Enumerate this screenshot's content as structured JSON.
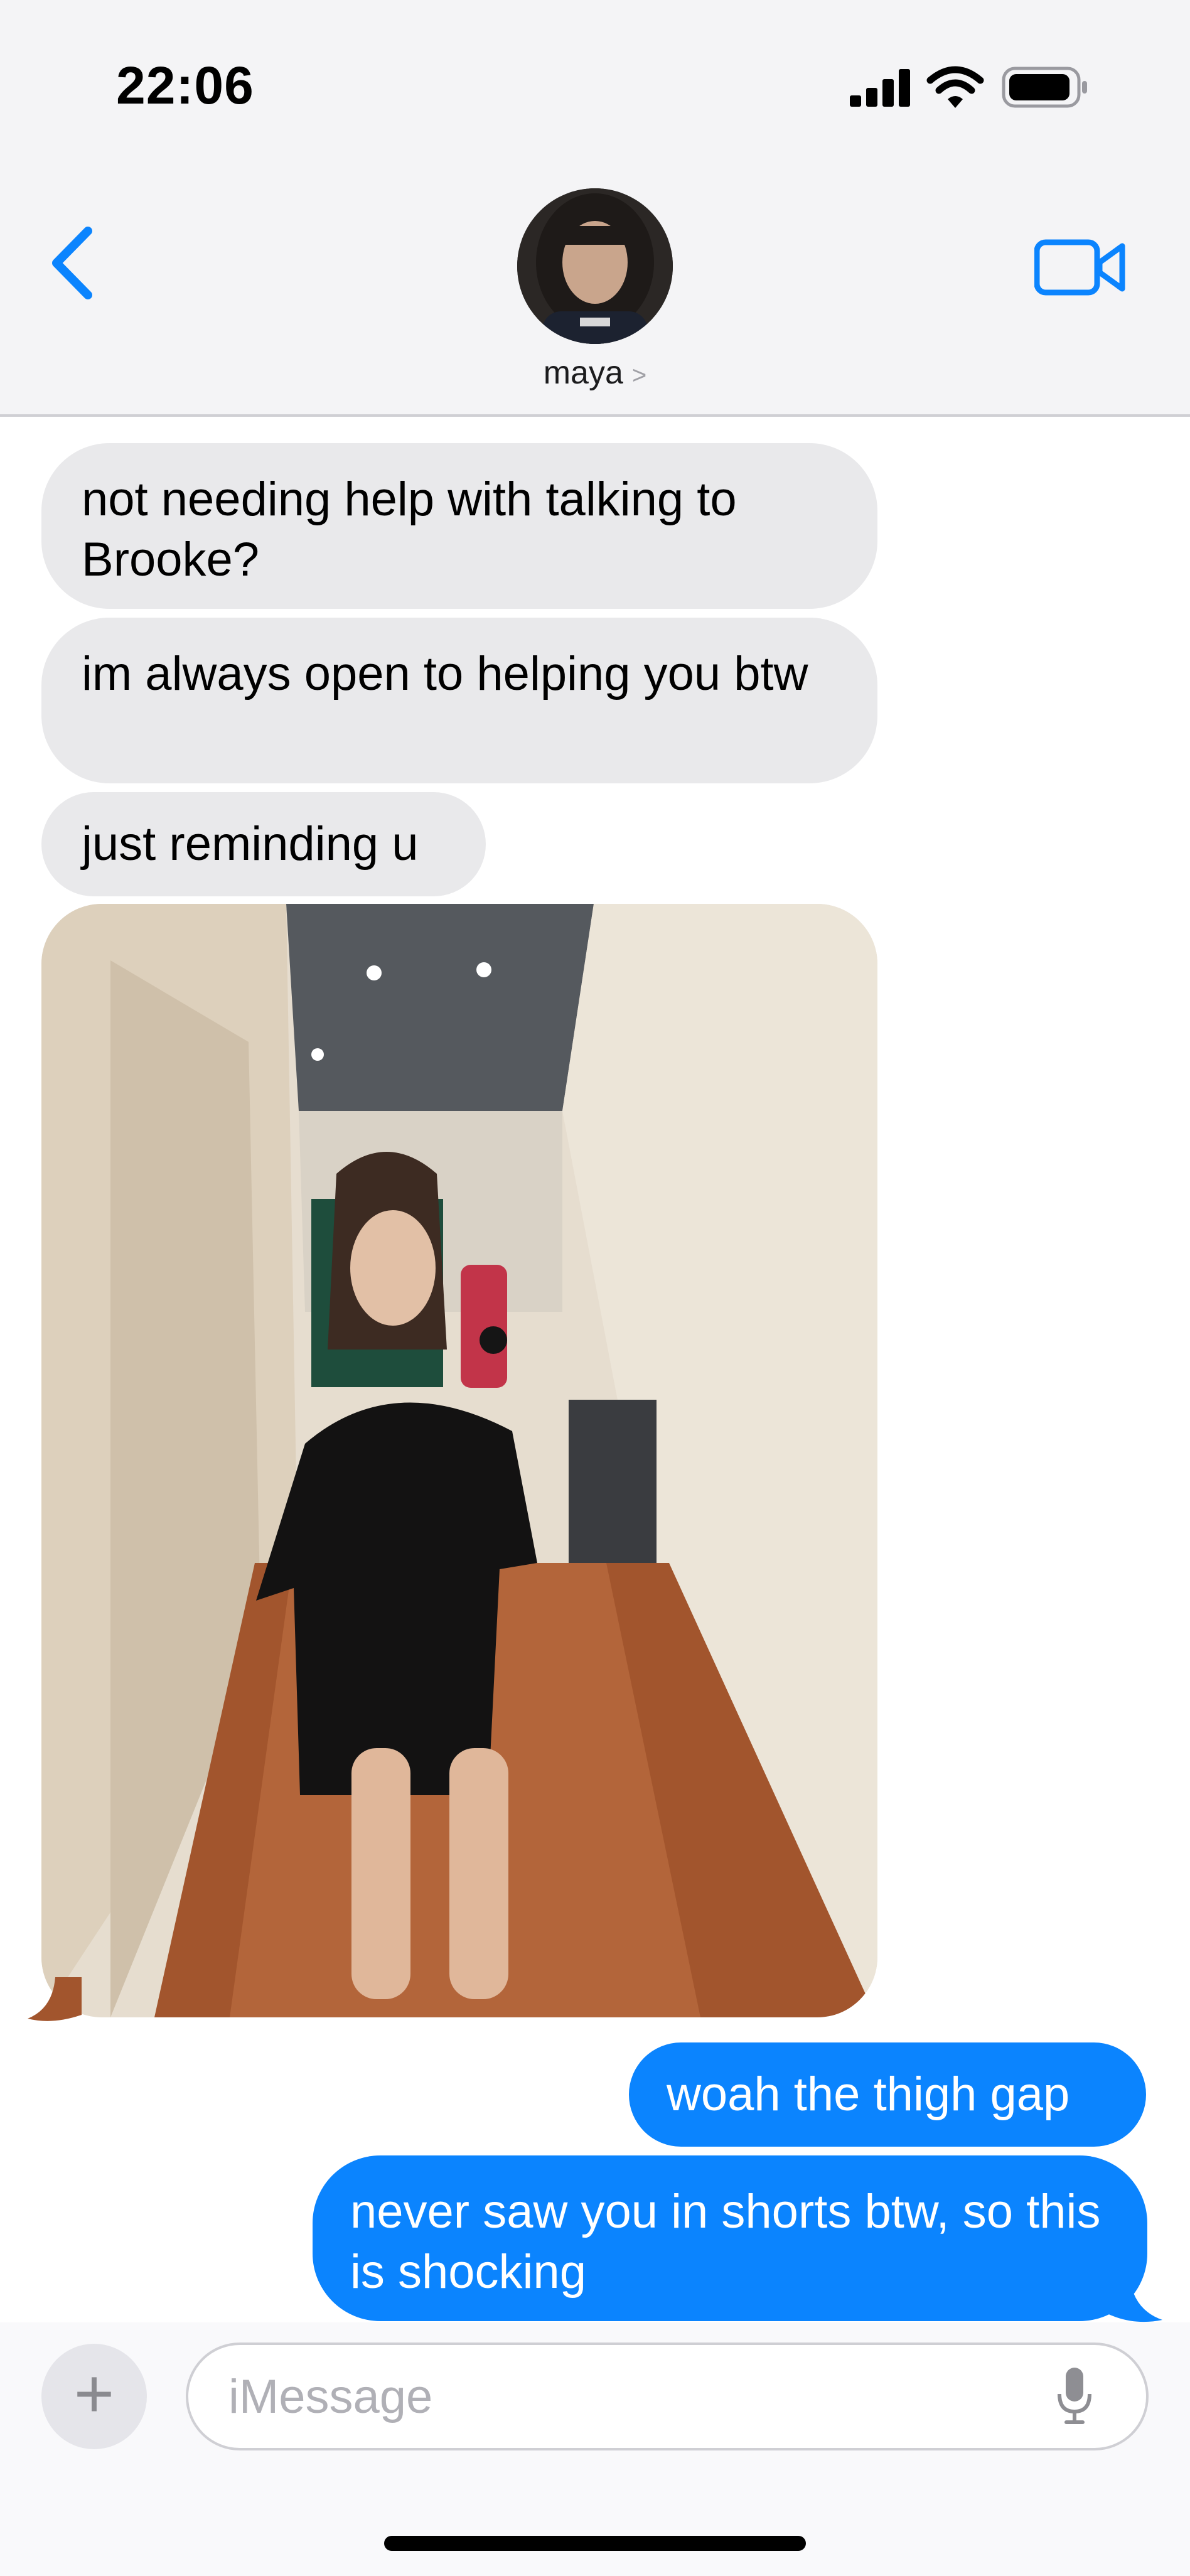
{
  "status_bar": {
    "time": "22:06",
    "icons": [
      "signal-icon",
      "wifi-icon",
      "battery-icon"
    ]
  },
  "header": {
    "back_icon": "chevron-left-icon",
    "contact_name": "maya",
    "name_chevron": ">",
    "video_icon": "video-camera-icon",
    "accent_color": "#0b84fe"
  },
  "messages": [
    {
      "direction": "received",
      "text": "not needing help with talking to Brooke?"
    },
    {
      "direction": "received",
      "text": "im always open to helping you btw"
    },
    {
      "direction": "received",
      "text": "just reminding u"
    },
    {
      "direction": "received",
      "type": "photo"
    },
    {
      "direction": "sent",
      "text": "woah the thigh gap"
    },
    {
      "direction": "sent",
      "text": "never saw you in shorts btw, so this is shocking"
    }
  ],
  "colors": {
    "received_bubble": "#e9e9eb",
    "sent_bubble": "#0b84fe"
  },
  "composer": {
    "plus_label": "+",
    "placeholder": "iMessage",
    "mic_icon": "microphone-icon"
  }
}
